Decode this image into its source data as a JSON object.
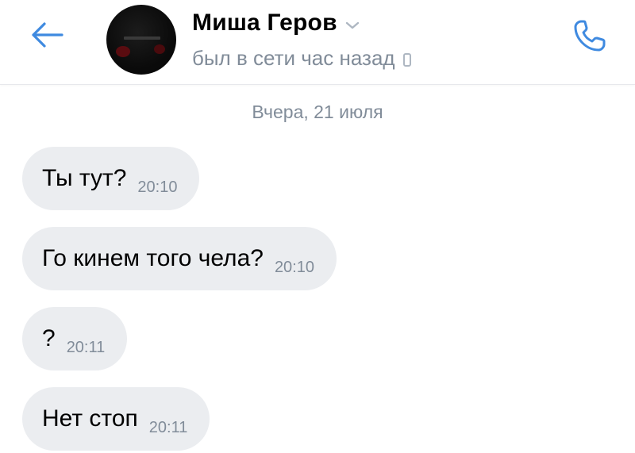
{
  "header": {
    "back_icon": "arrow-left-icon",
    "contact_name": "Миша Геров",
    "status": "был в сети час назад",
    "status_device_icon": "mobile-phone-icon",
    "call_icon": "phone-call-icon",
    "accent_color": "#3f8ae0"
  },
  "chat": {
    "date_separator": "Вчера, 21 июля",
    "messages": [
      {
        "text": "Ты тут?",
        "time": "20:10"
      },
      {
        "text": "Го кинем того чела?",
        "time": "20:10"
      },
      {
        "text": "?",
        "time": "20:11"
      },
      {
        "text": "Нет стоп",
        "time": "20:11"
      }
    ]
  },
  "colors": {
    "bubble_bg": "#ebedf0",
    "secondary_text": "#818c99",
    "primary_text": "#000000"
  }
}
